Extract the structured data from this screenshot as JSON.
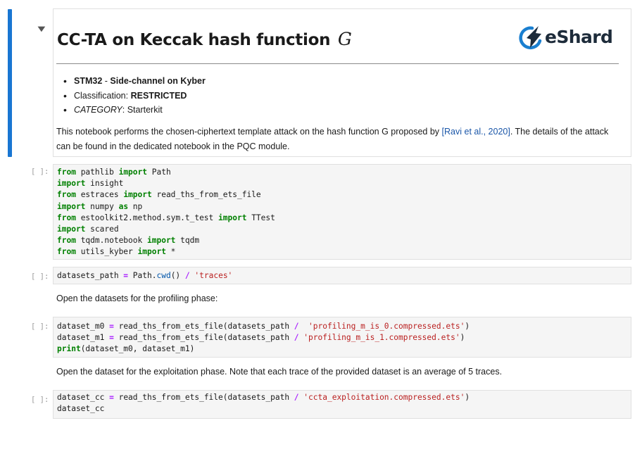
{
  "markdown_cell": {
    "title": "CC-TA on Keccak hash function",
    "title_symbol": "G",
    "logo_text": "eShard",
    "bullets": {
      "b1_bold1": "STM32",
      "b1_sep": " - ",
      "b1_bold2": "Side-channel on Kyber",
      "b2_label": "Classification: ",
      "b2_value": "RESTRICTED",
      "b3_label": "CATEGORY",
      "b3_value": ": Starterkit"
    },
    "paragraph_before": "This notebook performs the chosen-ciphertext template attack on the hash function G proposed by ",
    "paragraph_link": "[Ravi et al., 2020]",
    "paragraph_after": ". The details of the attack can be found in the dedicated notebook in the PQC module."
  },
  "prompts": {
    "cell1": "[ ]:",
    "cell2": "[ ]:",
    "cell3": "[ ]:",
    "cell4": "[ ]:"
  },
  "code": {
    "cell1": [
      {
        "t": "from",
        "c": "kw"
      },
      {
        "t": " pathlib ",
        "c": ""
      },
      {
        "t": "import",
        "c": "kw"
      },
      {
        "t": " Path\n",
        "c": ""
      },
      {
        "t": "import",
        "c": "kw"
      },
      {
        "t": " insight\n",
        "c": ""
      },
      {
        "t": "from",
        "c": "kw"
      },
      {
        "t": " estraces ",
        "c": ""
      },
      {
        "t": "import",
        "c": "kw"
      },
      {
        "t": " read_ths_from_ets_file\n",
        "c": ""
      },
      {
        "t": "import",
        "c": "kw"
      },
      {
        "t": " numpy ",
        "c": ""
      },
      {
        "t": "as",
        "c": "kw"
      },
      {
        "t": " np\n",
        "c": ""
      },
      {
        "t": "from",
        "c": "kw"
      },
      {
        "t": " estoolkit2.method.sym.t_test ",
        "c": ""
      },
      {
        "t": "import",
        "c": "kw"
      },
      {
        "t": " TTest\n",
        "c": ""
      },
      {
        "t": "import",
        "c": "kw"
      },
      {
        "t": " scared\n",
        "c": ""
      },
      {
        "t": "from",
        "c": "kw"
      },
      {
        "t": " tqdm.notebook ",
        "c": ""
      },
      {
        "t": "import",
        "c": "kw"
      },
      {
        "t": " tqdm\n",
        "c": ""
      },
      {
        "t": "from",
        "c": "kw"
      },
      {
        "t": " utils_kyber ",
        "c": ""
      },
      {
        "t": "import",
        "c": "kw"
      },
      {
        "t": " *",
        "c": ""
      }
    ],
    "cell2": [
      {
        "t": "datasets_path ",
        "c": ""
      },
      {
        "t": "=",
        "c": "op"
      },
      {
        "t": " Path.",
        "c": ""
      },
      {
        "t": "cwd",
        "c": "fn"
      },
      {
        "t": "() ",
        "c": ""
      },
      {
        "t": "/",
        "c": "op"
      },
      {
        "t": " ",
        "c": ""
      },
      {
        "t": "'traces'",
        "c": "str"
      }
    ],
    "cell3": [
      {
        "t": "dataset_m0 ",
        "c": ""
      },
      {
        "t": "=",
        "c": "op"
      },
      {
        "t": " read_ths_from_ets_file(datasets_path ",
        "c": ""
      },
      {
        "t": "/",
        "c": "op"
      },
      {
        "t": "  ",
        "c": ""
      },
      {
        "t": "'profiling_m_is_0.compressed.ets'",
        "c": "str"
      },
      {
        "t": ")\n",
        "c": ""
      },
      {
        "t": "dataset_m1 ",
        "c": ""
      },
      {
        "t": "=",
        "c": "op"
      },
      {
        "t": " read_ths_from_ets_file(datasets_path ",
        "c": ""
      },
      {
        "t": "/",
        "c": "op"
      },
      {
        "t": " ",
        "c": ""
      },
      {
        "t": "'profiling_m_is_1.compressed.ets'",
        "c": "str"
      },
      {
        "t": ")\n",
        "c": ""
      },
      {
        "t": "print",
        "c": "kw"
      },
      {
        "t": "(dataset_m0, dataset_m1)",
        "c": ""
      }
    ],
    "cell4": [
      {
        "t": "dataset_cc ",
        "c": ""
      },
      {
        "t": "=",
        "c": "op"
      },
      {
        "t": " read_ths_from_ets_file(datasets_path ",
        "c": ""
      },
      {
        "t": "/",
        "c": "op"
      },
      {
        "t": " ",
        "c": ""
      },
      {
        "t": "'ccta_exploitation.compressed.ets'",
        "c": "str"
      },
      {
        "t": ")\n",
        "c": ""
      },
      {
        "t": "dataset_cc",
        "c": ""
      }
    ]
  },
  "text_cells": {
    "profiling": "Open the datasets for the profiling phase:",
    "exploitation": "Open the dataset for the exploitation phase. Note that each trace of the provided dataset is an average of 5 traces."
  },
  "colors": {
    "active_bar": "#1976d2",
    "keyword": "#008000",
    "string": "#ba2121",
    "link": "#1a56a8",
    "code_bg": "#f5f5f5"
  }
}
